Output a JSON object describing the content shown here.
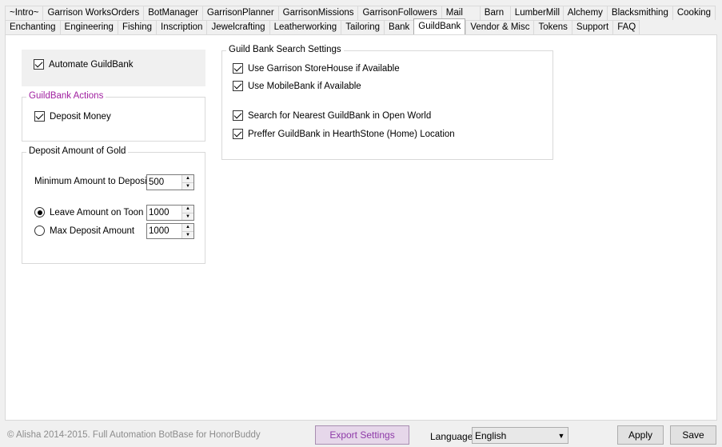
{
  "tabs_row1": [
    "~Intro~",
    "Garrison WorksOrders",
    "BotManager",
    "GarrisonPlanner",
    "GarrisonMissions",
    "GarrisonFollowers",
    "Mail",
    "Barn",
    "LumberMill",
    "Alchemy",
    "Blacksmithing",
    "Cooking"
  ],
  "tabs_row2": [
    "Enchanting",
    "Engineering",
    "Fishing",
    "Inscription",
    "Jewelcrafting",
    "Leatherworking",
    "Tailoring",
    "Bank",
    "GuildBank",
    "Vendor & Misc",
    "Tokens",
    "Support",
    "FAQ"
  ],
  "active_tab": "GuildBank",
  "automate": {
    "label": "Automate GuildBank",
    "checked": true
  },
  "actions": {
    "title": "GuildBank Actions",
    "deposit_money": {
      "label": "Deposit Money",
      "checked": true
    }
  },
  "deposit": {
    "title": "Deposit Amount of Gold",
    "min_label": "Minimum Amount to Deposit",
    "min_value": "500",
    "leave_label": "Leave Amount on Toon",
    "leave_value": "1000",
    "leave_selected": true,
    "max_label": "Max Deposit Amount",
    "max_value": "1000",
    "max_selected": false
  },
  "search": {
    "title": "Guild Bank Search Settings",
    "storehouse": {
      "label": "Use Garrison StoreHouse if Available",
      "checked": true
    },
    "mobilebank": {
      "label": "Use MobileBank if Available",
      "checked": true
    },
    "nearest": {
      "label": "Search for Nearest GuildBank in Open World",
      "checked": true
    },
    "hearthstone": {
      "label": "Preffer GuildBank in HearthStone (Home) Location",
      "checked": true
    }
  },
  "footer": {
    "copyright": "© Alisha 2014-2015. Full Automation BotBase for HonorBuddy",
    "export_label": "Export Settings",
    "language_label": "Language",
    "language_value": "English",
    "apply_label": "Apply",
    "save_label": "Save"
  },
  "colors": {
    "accent_purple": "#a020a0",
    "export_bg": "#e6d7ea"
  }
}
